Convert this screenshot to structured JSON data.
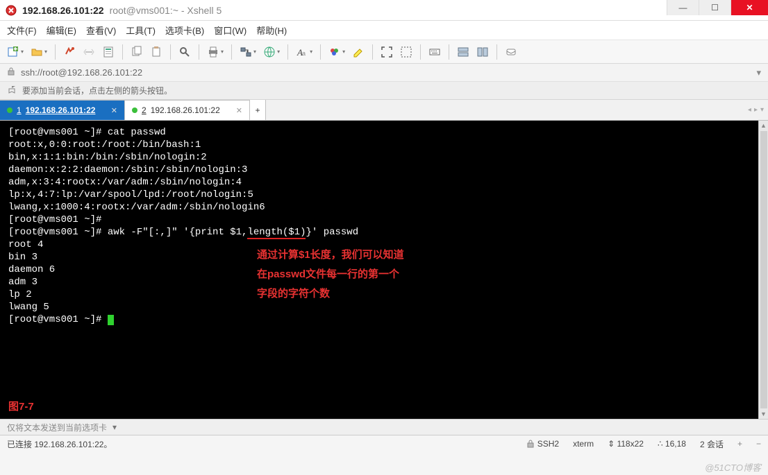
{
  "titlebar": {
    "main": "192.168.26.101:22",
    "sub": "root@vms001:~ - Xshell 5"
  },
  "menu": {
    "file": "文件(F)",
    "edit": "编辑(E)",
    "view": "查看(V)",
    "tools": "工具(T)",
    "tabs": "选项卡(B)",
    "window": "窗口(W)",
    "help": "帮助(H)"
  },
  "address": {
    "url": "ssh://root@192.168.26.101:22"
  },
  "hint": {
    "text": "要添加当前会话，点击左侧的箭头按钮。"
  },
  "tabs": [
    {
      "index": "1",
      "label": "192.168.26.101:22",
      "active": true
    },
    {
      "index": "2",
      "label": "192.168.26.101:22",
      "active": false
    }
  ],
  "tab_add": "+",
  "terminal": {
    "lines": [
      "[root@vms001 ~]# cat passwd",
      "root:x,0:0:root:/root:/bin/bash:1",
      "bin,x:1:1:bin:/bin:/sbin/nologin:2",
      "daemon:x:2:2:daemon:/sbin:/sbin/nologin:3",
      "adm,x:3:4:rootx:/var/adm:/sbin/nologin:4",
      "lp:x,4:7:lp:/var/spool/lpd:/root/nologin:5",
      "lwang,x:1000:4:rootx:/var/adm:/sbin/nologin6",
      "[root@vms001 ~]#",
      "[root@vms001 ~]# awk -F\"[:,]\" '{print $1,length($1)}' passwd",
      "root 4",
      "bin 3",
      "daemon 6",
      "adm 3",
      "lp 2",
      "lwang 5",
      "[root@vms001 ~]# "
    ],
    "underline_segment": "length($1)",
    "annotation_l1": "通过计算$1长度，我们可以知道",
    "annotation_l2": "在passwd文件每一行的第一个",
    "annotation_l3": "字段的字符个数",
    "figure_label": "图7-7"
  },
  "sendbar": {
    "text": "仅将文本发送到当前选项卡"
  },
  "status": {
    "left": "已连接 192.168.26.101:22。",
    "ssh": "SSH2",
    "term": "xterm",
    "size": "118x22",
    "rowcol": "16,18",
    "sessions": "2 会话"
  },
  "watermark": "@51CTO博客"
}
